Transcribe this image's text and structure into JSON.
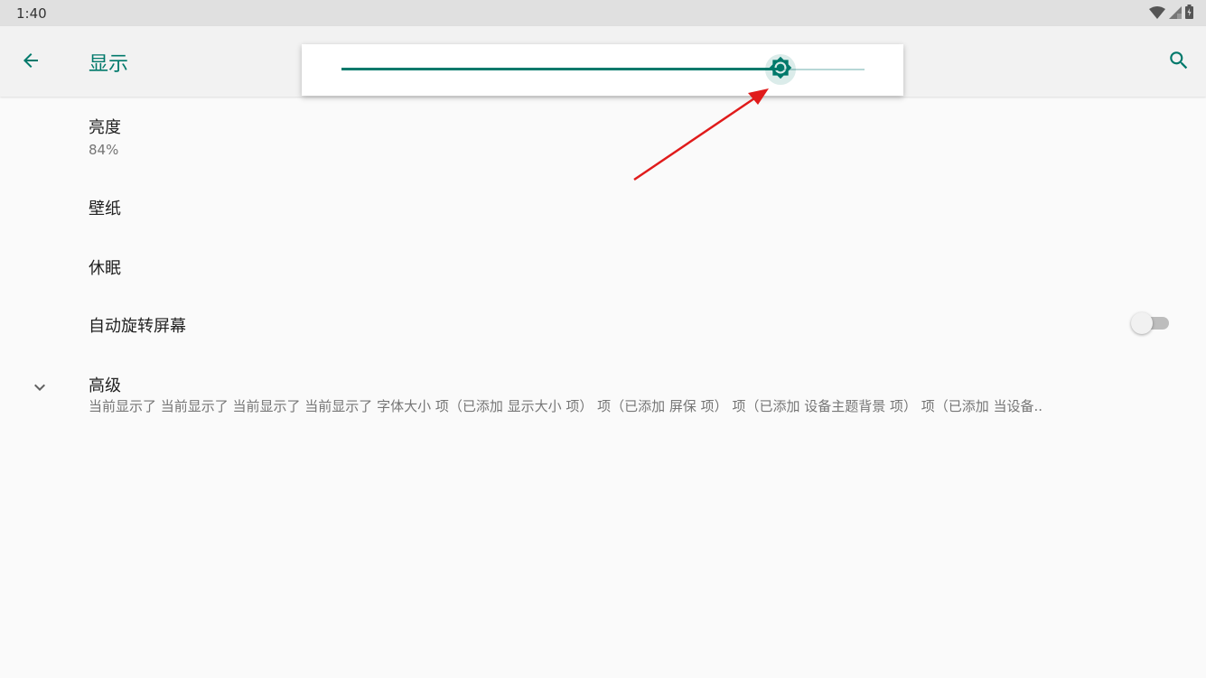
{
  "status_bar": {
    "time": "1:40",
    "icons": [
      "wifi-icon",
      "signal-icon",
      "battery-icon"
    ]
  },
  "app_bar": {
    "title": "显示",
    "back_icon": "arrow-left-icon",
    "search_icon": "search-icon"
  },
  "brightness_slider": {
    "value_fraction": 0.84,
    "thumb_icon": "brightness-icon"
  },
  "settings": {
    "brightness": {
      "title": "亮度",
      "summary": "84%"
    },
    "wallpaper": {
      "title": "壁纸"
    },
    "sleep": {
      "title": "休眠"
    },
    "auto_rotate": {
      "title": "自动旋转屏幕",
      "enabled": false
    },
    "advanced": {
      "title": "高级",
      "summary": "当前显示了 当前显示了 当前显示了 当前显示了 字体大小 项（已添加 显示大小 项） 项（已添加 屏保 项） 项（已添加 设备主题背景 项） 项（已添加 当设备..",
      "expand_icon": "chevron-down-icon"
    }
  },
  "colors": {
    "accent": "#00796b",
    "track_inactive": "#b7d7d6",
    "annotation": "#e01b1b"
  }
}
